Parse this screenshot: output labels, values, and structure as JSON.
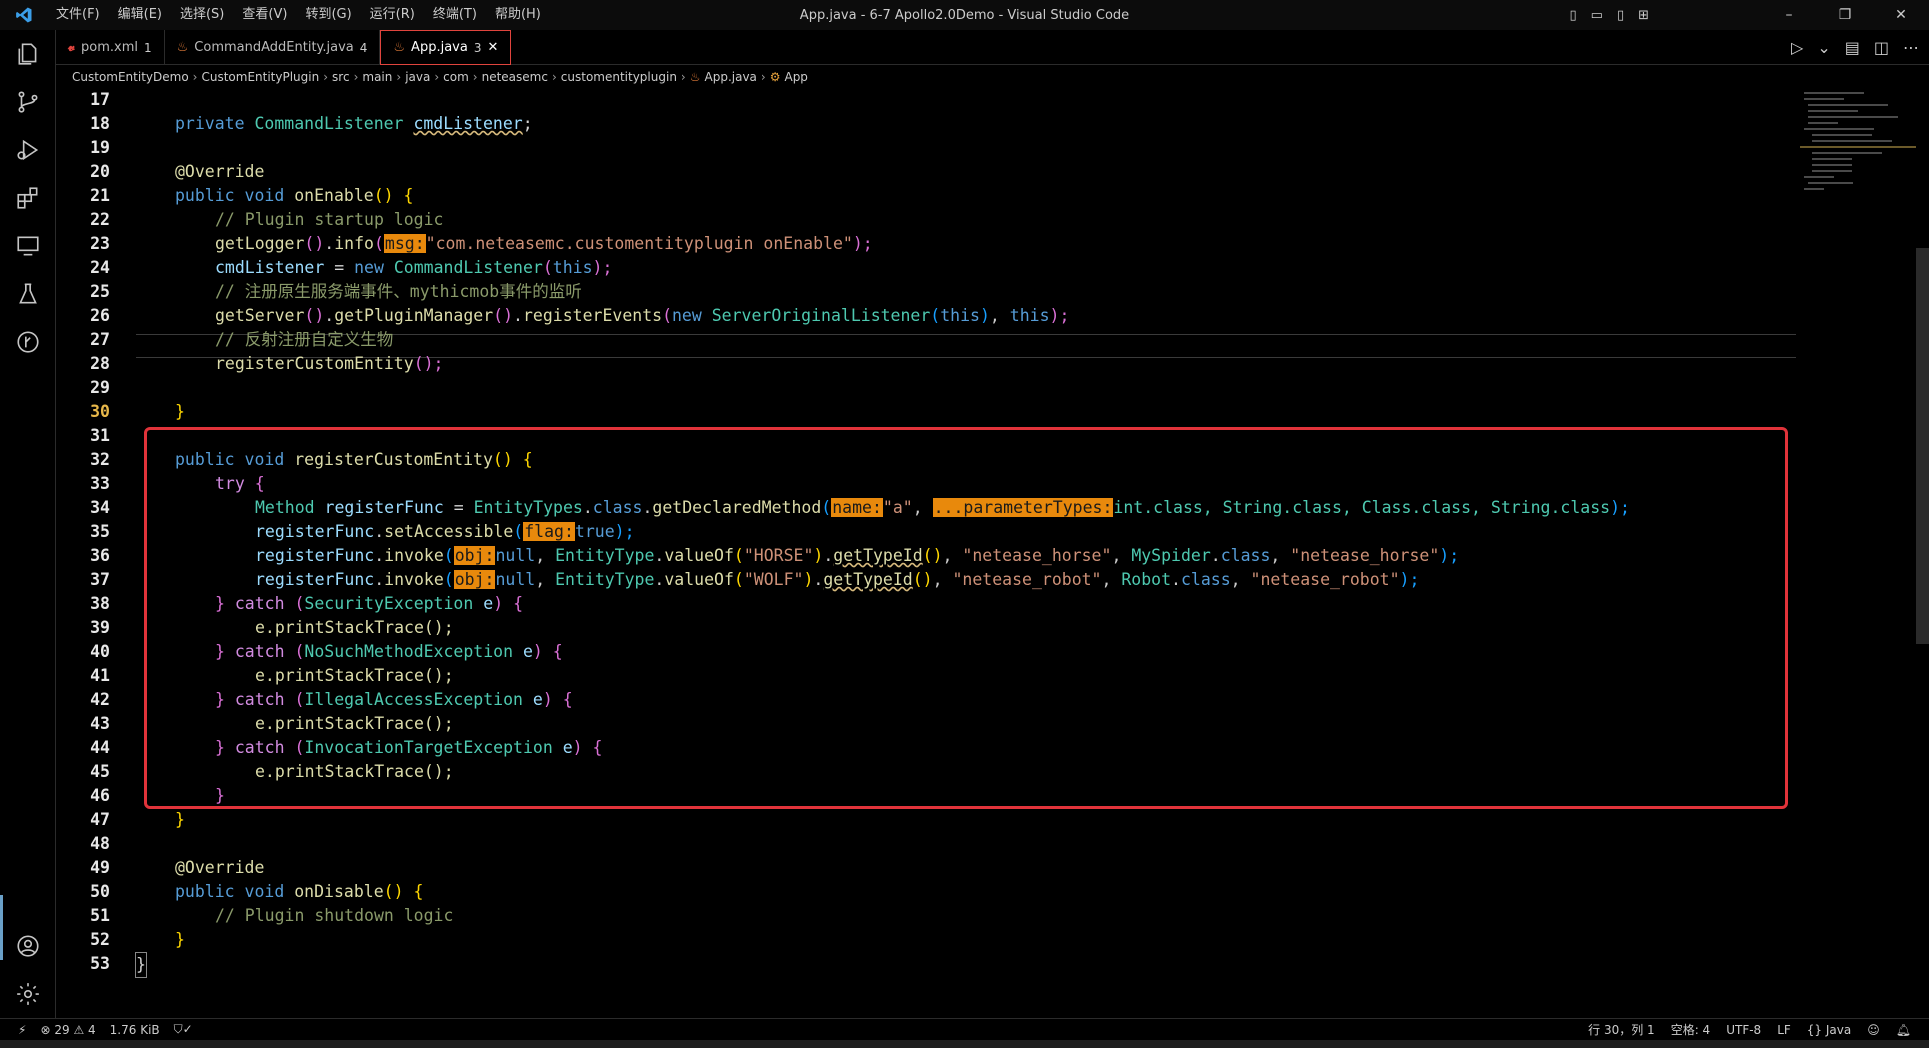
{
  "window": {
    "title": "App.java - 6-7 Apollo2.0Demo - Visual Studio Code",
    "menu": [
      "文件(F)",
      "编辑(E)",
      "选择(S)",
      "查看(V)",
      "转到(G)",
      "运行(R)",
      "终端(T)",
      "帮助(H)"
    ],
    "controls": {
      "minimize": "–",
      "restore": "❐",
      "close": "✕"
    }
  },
  "tabs": [
    {
      "label": "pom.xml",
      "count": "1",
      "icon": "maven-icon"
    },
    {
      "label": "CommandAddEntity.java",
      "count": "4",
      "icon": "java-icon"
    },
    {
      "label": "App.java",
      "count": "3",
      "icon": "java-icon",
      "active": true
    }
  ],
  "breadcrumb": [
    "CustomEntityDemo",
    "CustomEntityPlugin",
    "src",
    "main",
    "java",
    "com",
    "neteasemc",
    "customentityplugin",
    "App.java",
    "App"
  ],
  "lines": [
    {
      "n": "17",
      "y": 0
    },
    {
      "n": "18",
      "y": 1
    },
    {
      "n": "19",
      "y": 2
    },
    {
      "n": "20",
      "y": 3
    },
    {
      "n": "21",
      "y": 4
    },
    {
      "n": "22",
      "y": 5
    },
    {
      "n": "23",
      "y": 6
    },
    {
      "n": "24",
      "y": 7
    },
    {
      "n": "25",
      "y": 8
    },
    {
      "n": "26",
      "y": 9
    },
    {
      "n": "27",
      "y": 10
    },
    {
      "n": "28",
      "y": 11
    },
    {
      "n": "29",
      "y": 12
    },
    {
      "n": "30",
      "y": 13
    },
    {
      "n": "31",
      "y": 14
    },
    {
      "n": "32",
      "y": 15
    },
    {
      "n": "33",
      "y": 16
    },
    {
      "n": "34",
      "y": 17
    },
    {
      "n": "35",
      "y": 18
    },
    {
      "n": "36",
      "y": 19
    },
    {
      "n": "37",
      "y": 20
    },
    {
      "n": "38",
      "y": 21
    },
    {
      "n": "39",
      "y": 22
    },
    {
      "n": "40",
      "y": 23
    },
    {
      "n": "41",
      "y": 24
    },
    {
      "n": "42",
      "y": 25
    },
    {
      "n": "43",
      "y": 26
    },
    {
      "n": "44",
      "y": 27
    },
    {
      "n": "45",
      "y": 28
    },
    {
      "n": "46",
      "y": 29
    },
    {
      "n": "47",
      "y": 30
    },
    {
      "n": "48",
      "y": 31
    },
    {
      "n": "49",
      "y": 32
    },
    {
      "n": "50",
      "y": 33
    },
    {
      "n": "51",
      "y": 34
    },
    {
      "n": "52",
      "y": 35
    },
    {
      "n": "53",
      "y": 36
    }
  ],
  "code": {
    "l17": {
      "kw": "private",
      "type": "CommandListener",
      "var": "cmdListener",
      "end": ";"
    },
    "l19": "@Override",
    "l20": {
      "kw1": "public",
      "kw2": "void",
      "fn": "onEnable",
      "rest": "() {"
    },
    "l21": "// Plugin startup logic",
    "l22": {
      "fn1": "getLogger",
      "fn2": "info",
      "hint": "msg:",
      "str": "\"com.neteasemc.customentityplugin onEnable\"",
      "end": ");"
    },
    "l23": {
      "var": "cmdListener",
      "op": " = ",
      "kw": "new",
      "type": "CommandListener",
      "arg": "this",
      "end": ");"
    },
    "l24": "// 注册原生服务端事件、mythicmob事件的监听",
    "l25": {
      "fn1": "getServer",
      "fn2": "getPluginManager",
      "fn3": "registerEvents",
      "kw": "new",
      "type": "ServerOriginalListener",
      "arg": "this",
      "arg2": "this",
      "end": ");"
    },
    "l26": "// 反射注册自定义生物",
    "l27": {
      "fn": "registerCustomEntity",
      "end": "();"
    },
    "l29": "}",
    "l31": {
      "kw1": "public",
      "kw2": "void",
      "fn": "registerCustomEntity",
      "rest": "() {"
    },
    "l32": {
      "kw": "try",
      "brace": "{"
    },
    "l33": {
      "type": "Method",
      "var": "registerFunc",
      "op": " = ",
      "type2": "EntityTypes",
      "kw": "class",
      "fn": "getDeclaredMethod",
      "hint1": "name:",
      "str": "\"a\"",
      "hint2": "...parameterTypes:",
      "rest": "int.class, String.class, Class.class, String.class",
      "end": ");"
    },
    "l34": {
      "var": "registerFunc",
      "fn": "setAccessible",
      "hint": "flag:",
      "val": "true",
      "end": ");"
    },
    "l35": {
      "var": "registerFunc",
      "fn": "invoke",
      "hint": "obj:",
      "val": "null",
      "type": "EntityType",
      "fn2": "valueOf",
      "str1": "\"HORSE\"",
      "fn3": "getTypeId",
      "str2": "\"netease_horse\"",
      "type2": "MySpider",
      "kw": "class",
      "str3": "\"netease_horse\"",
      "end": ");"
    },
    "l36": {
      "var": "registerFunc",
      "fn": "invoke",
      "hint": "obj:",
      "val": "null",
      "type": "EntityType",
      "fn2": "valueOf",
      "str1": "\"WOLF\"",
      "fn3": "getTypeId",
      "str2": "\"netease_robot\"",
      "type2": "Robot",
      "kw": "class",
      "str3": "\"netease_robot\"",
      "end": ");"
    },
    "catches": [
      {
        "line": "37",
        "exc": "SecurityException"
      },
      {
        "line": "39",
        "exc": "NoSuchMethodException"
      },
      {
        "line": "41",
        "exc": "IllegalAccessException"
      },
      {
        "line": "43",
        "exc": "InvocationTargetException"
      }
    ],
    "print": "e.printStackTrace();",
    "catch_kw": "catch",
    "l48": "@Override",
    "l49": {
      "kw1": "public",
      "kw2": "void",
      "fn": "onDisable",
      "rest": "() {"
    },
    "l50": "// Plugin shutdown logic"
  },
  "status": {
    "errors": "29",
    "warnings": "4",
    "size": "1.76 KiB",
    "position": "行 30，列 1",
    "spaces": "空格: 4",
    "encoding": "UTF-8",
    "eol": "LF",
    "language": "Java"
  },
  "colors": {
    "accent_box": "#e0333a",
    "hint_bg": "#e8890c"
  }
}
